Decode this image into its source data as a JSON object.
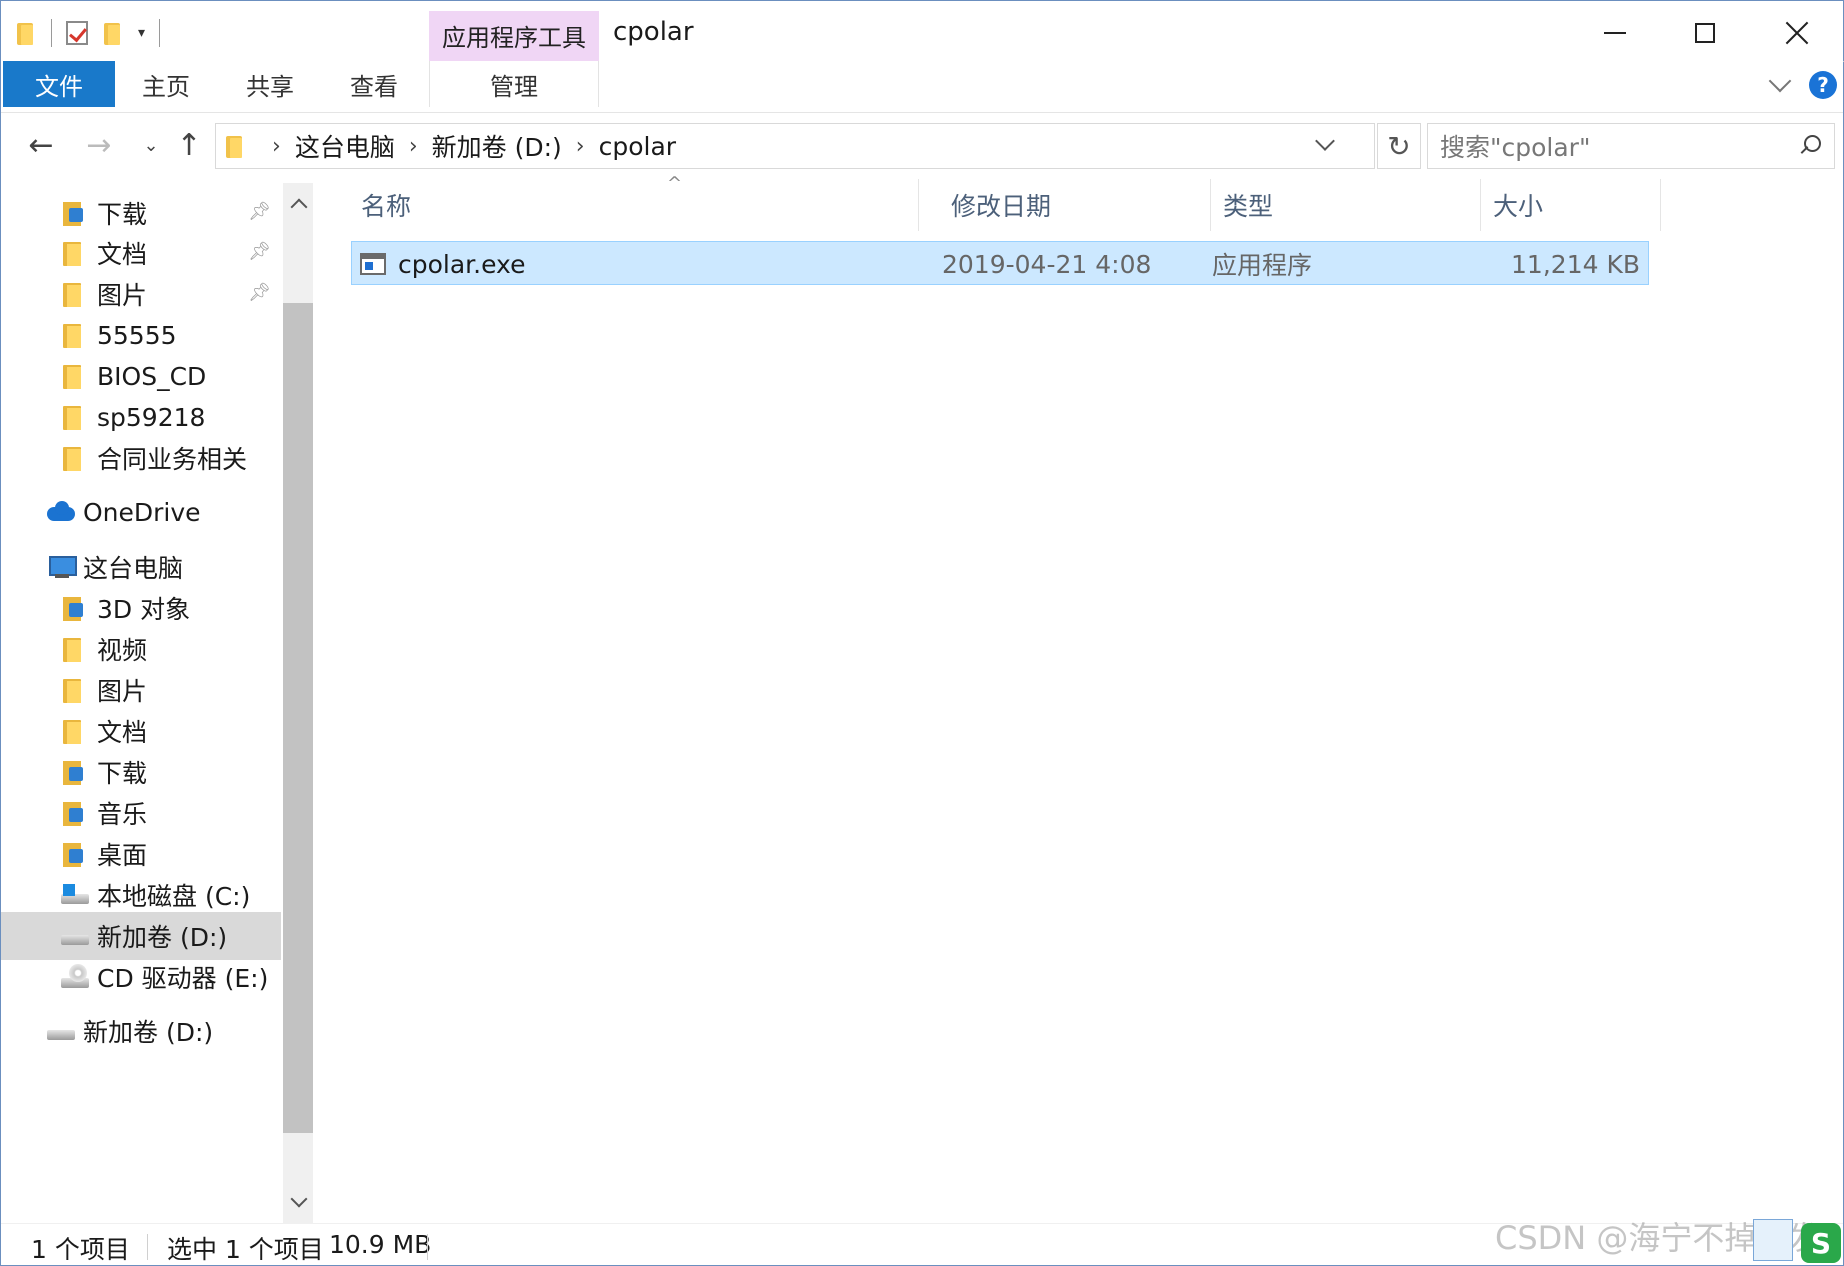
{
  "window": {
    "title": "cpolar",
    "contextual_tab": "应用程序工具"
  },
  "ribbon": {
    "tabs": [
      "文件",
      "主页",
      "共享",
      "查看",
      "管理"
    ]
  },
  "address": {
    "crumbs": [
      "这台电脑",
      "新加卷 (D:)",
      "cpolar"
    ],
    "search_placeholder": "搜索\"cpolar\""
  },
  "navpane": {
    "items": [
      {
        "label": "下载",
        "icon": "download-folder-icon",
        "pinned": true
      },
      {
        "label": "文档",
        "icon": "documents-folder-icon",
        "pinned": true
      },
      {
        "label": "图片",
        "icon": "pictures-folder-icon",
        "pinned": true
      },
      {
        "label": "55555",
        "icon": "folder-icon"
      },
      {
        "label": "BIOS_CD",
        "icon": "folder-icon"
      },
      {
        "label": "sp59218",
        "icon": "folder-icon"
      },
      {
        "label": "合同业务相关",
        "icon": "folder-icon"
      },
      {
        "label": "OneDrive",
        "icon": "onedrive-icon"
      },
      {
        "label": "这台电脑",
        "icon": "this-pc-icon"
      },
      {
        "label": "3D 对象",
        "icon": "3d-objects-icon"
      },
      {
        "label": "视频",
        "icon": "videos-folder-icon"
      },
      {
        "label": "图片",
        "icon": "pictures-folder-icon"
      },
      {
        "label": "文档",
        "icon": "documents-folder-icon"
      },
      {
        "label": "下载",
        "icon": "download-folder-icon"
      },
      {
        "label": "音乐",
        "icon": "music-folder-icon"
      },
      {
        "label": "桌面",
        "icon": "desktop-folder-icon"
      },
      {
        "label": "本地磁盘 (C:)",
        "icon": "system-drive-icon"
      },
      {
        "label": "新加卷 (D:)",
        "icon": "drive-icon",
        "selected": true
      },
      {
        "label": "CD 驱动器 (E:)",
        "icon": "cd-drive-icon"
      },
      {
        "label": "新加卷 (D:)",
        "icon": "drive-icon"
      }
    ]
  },
  "columns": {
    "name": "名称",
    "date": "修改日期",
    "type": "类型",
    "size": "大小"
  },
  "files": [
    {
      "name": "cpolar.exe",
      "date": "2019-04-21 4:08",
      "type": "应用程序",
      "size": "11,214 KB",
      "selected": true
    }
  ],
  "status": {
    "count": "1 个项目",
    "selection": "选中 1 个项目",
    "selection_size": "10.9 MB"
  },
  "watermark": "CSDN @海宁不掉头发",
  "colors": {
    "accent": "#1979ca",
    "tool_tab": "#f0d6f5",
    "selection": "#cce8ff"
  }
}
